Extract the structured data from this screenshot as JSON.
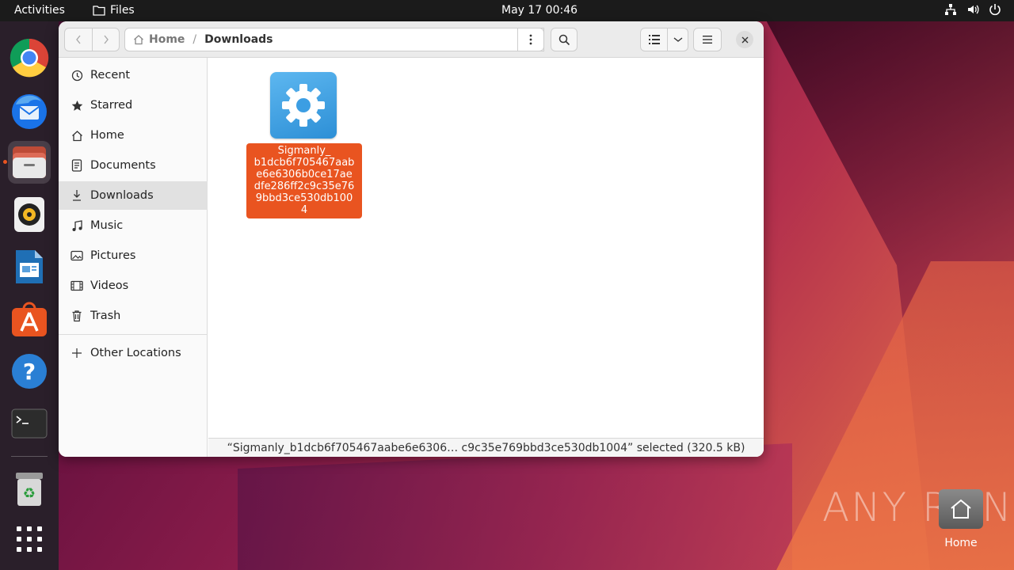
{
  "topbar": {
    "activities": "Activities",
    "app_name": "Files",
    "clock": "May 17  00:46"
  },
  "dock": {
    "apps": [
      {
        "name": "Google Chrome",
        "icon": "chrome-icon"
      },
      {
        "name": "Thunderbird",
        "icon": "thunderbird-icon"
      },
      {
        "name": "Files",
        "icon": "files-icon",
        "active": true
      },
      {
        "name": "Rhythmbox",
        "icon": "rhythmbox-icon"
      },
      {
        "name": "LibreOffice Writer",
        "icon": "writer-icon"
      },
      {
        "name": "Ubuntu Software",
        "icon": "software-icon"
      },
      {
        "name": "Help",
        "icon": "help-icon"
      },
      {
        "name": "Terminal",
        "icon": "terminal-icon"
      },
      {
        "name": "Trash",
        "icon": "trash-icon"
      },
      {
        "name": "Show Applications",
        "icon": "app-grid-icon"
      }
    ]
  },
  "window": {
    "path": {
      "home": "Home",
      "separator": "/",
      "current": "Downloads"
    },
    "sidebar": {
      "items": [
        {
          "label": "Recent",
          "icon": "clock-icon"
        },
        {
          "label": "Starred",
          "icon": "star-icon"
        },
        {
          "label": "Home",
          "icon": "home-icon"
        },
        {
          "label": "Documents",
          "icon": "document-icon"
        },
        {
          "label": "Downloads",
          "icon": "download-icon",
          "selected": true
        },
        {
          "label": "Music",
          "icon": "music-icon"
        },
        {
          "label": "Pictures",
          "icon": "picture-icon"
        },
        {
          "label": "Videos",
          "icon": "video-icon"
        },
        {
          "label": "Trash",
          "icon": "trash-icon"
        }
      ],
      "other_locations": "Other Locations"
    },
    "files": [
      {
        "name": "Sigmanly_\nb1dcb6f705467aab\ne6e6306b0ce17ae\ndfe286ff2c9c35e76\n9bbd3ce530db100\n4",
        "icon": "executable-gear-icon",
        "selected": true
      }
    ],
    "status": "“Sigmanly_b1dcb6f705467aabe6e6306…  c9c35e769bbd3ce530db1004” selected (320.5 kB)"
  },
  "desktop": {
    "home_label": "Home",
    "watermark": "ANY RUN"
  },
  "colors": {
    "accent": "#e95420",
    "topbar": "#1b1b1b",
    "dock": "#2a1f2a"
  }
}
